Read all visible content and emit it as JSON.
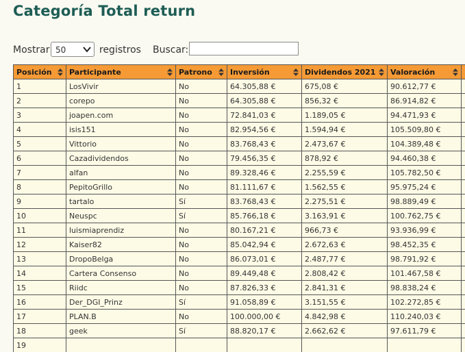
{
  "page": {
    "title": "Categoría Total return"
  },
  "controls": {
    "show_label": "Mostrar",
    "page_size": "50",
    "records_label": "registros",
    "search_label": "Buscar:",
    "search_value": ""
  },
  "table": {
    "columns": [
      "Posición",
      "Participante",
      "Patrono",
      "Inversión",
      "Dividendos 2021",
      "Valoración",
      ""
    ],
    "rows": [
      [
        "1",
        "LosVivir",
        "No",
        "64.305,88 €",
        "675,08 €",
        "90.612,77 €",
        ""
      ],
      [
        "2",
        "corepo",
        "No",
        "64.305,88 €",
        "856,32 €",
        "86.914,82 €",
        ""
      ],
      [
        "3",
        "joapen.com",
        "No",
        "72.841,03 €",
        "1.189,05 €",
        "94.471,93 €",
        ""
      ],
      [
        "4",
        "isis151",
        "No",
        "82.954,56 €",
        "1.594,94 €",
        "105.509,80 €",
        ""
      ],
      [
        "5",
        "Vittorio",
        "No",
        "83.768,43 €",
        "2.473,67 €",
        "104.389,48 €",
        ""
      ],
      [
        "6",
        "Cazadividendos",
        "No",
        "79.456,35 €",
        "878,92 €",
        "94.460,38 €",
        ""
      ],
      [
        "7",
        "alfan",
        "No",
        "89.328,46 €",
        "2.255,59 €",
        "105.782,50 €",
        ""
      ],
      [
        "8",
        "PepitoGrillo",
        "No",
        "81.111,67 €",
        "1.562,55 €",
        "95.975,24 €",
        ""
      ],
      [
        "9",
        "tartalo",
        "Sí",
        "83.768,43 €",
        "2.275,51 €",
        "98.889,49 €",
        ""
      ],
      [
        "10",
        "Neuspc",
        "Sí",
        "85.766,18 €",
        "3.163,91 €",
        "100.762,75 €",
        ""
      ],
      [
        "11",
        "luismiaprendiz",
        "No",
        "80.167,21 €",
        "966,73 €",
        "93.936,99 €",
        ""
      ],
      [
        "12",
        "Kaiser82",
        "No",
        "85.042,94 €",
        "2.672,63 €",
        "98.452,35 €",
        ""
      ],
      [
        "13",
        "DropoBelga",
        "No",
        "86.073,01 €",
        "2.487,77 €",
        "98.791,92 €",
        ""
      ],
      [
        "14",
        "Cartera Consenso",
        "No",
        "89.449,48 €",
        "2.808,42 €",
        "101.467,58 €",
        ""
      ],
      [
        "15",
        "Riidc",
        "No",
        "87.826,33 €",
        "2.841,31 €",
        "98.838,24 €",
        ""
      ],
      [
        "16",
        "Der_DGI_Prinz",
        "Sí",
        "91.058,89 €",
        "3.151,55 €",
        "102.272,85 €",
        ""
      ],
      [
        "17",
        "PLAN.B",
        "No",
        "100.000,00 €",
        "4.842,98 €",
        "110.240,03 €",
        ""
      ],
      [
        "18",
        "geek",
        "Sí",
        "88.820,17 €",
        "2.662,62 €",
        "97.611,79 €",
        ""
      ],
      [
        "19",
        "",
        "",
        "",
        "",
        "",
        ""
      ]
    ]
  }
}
